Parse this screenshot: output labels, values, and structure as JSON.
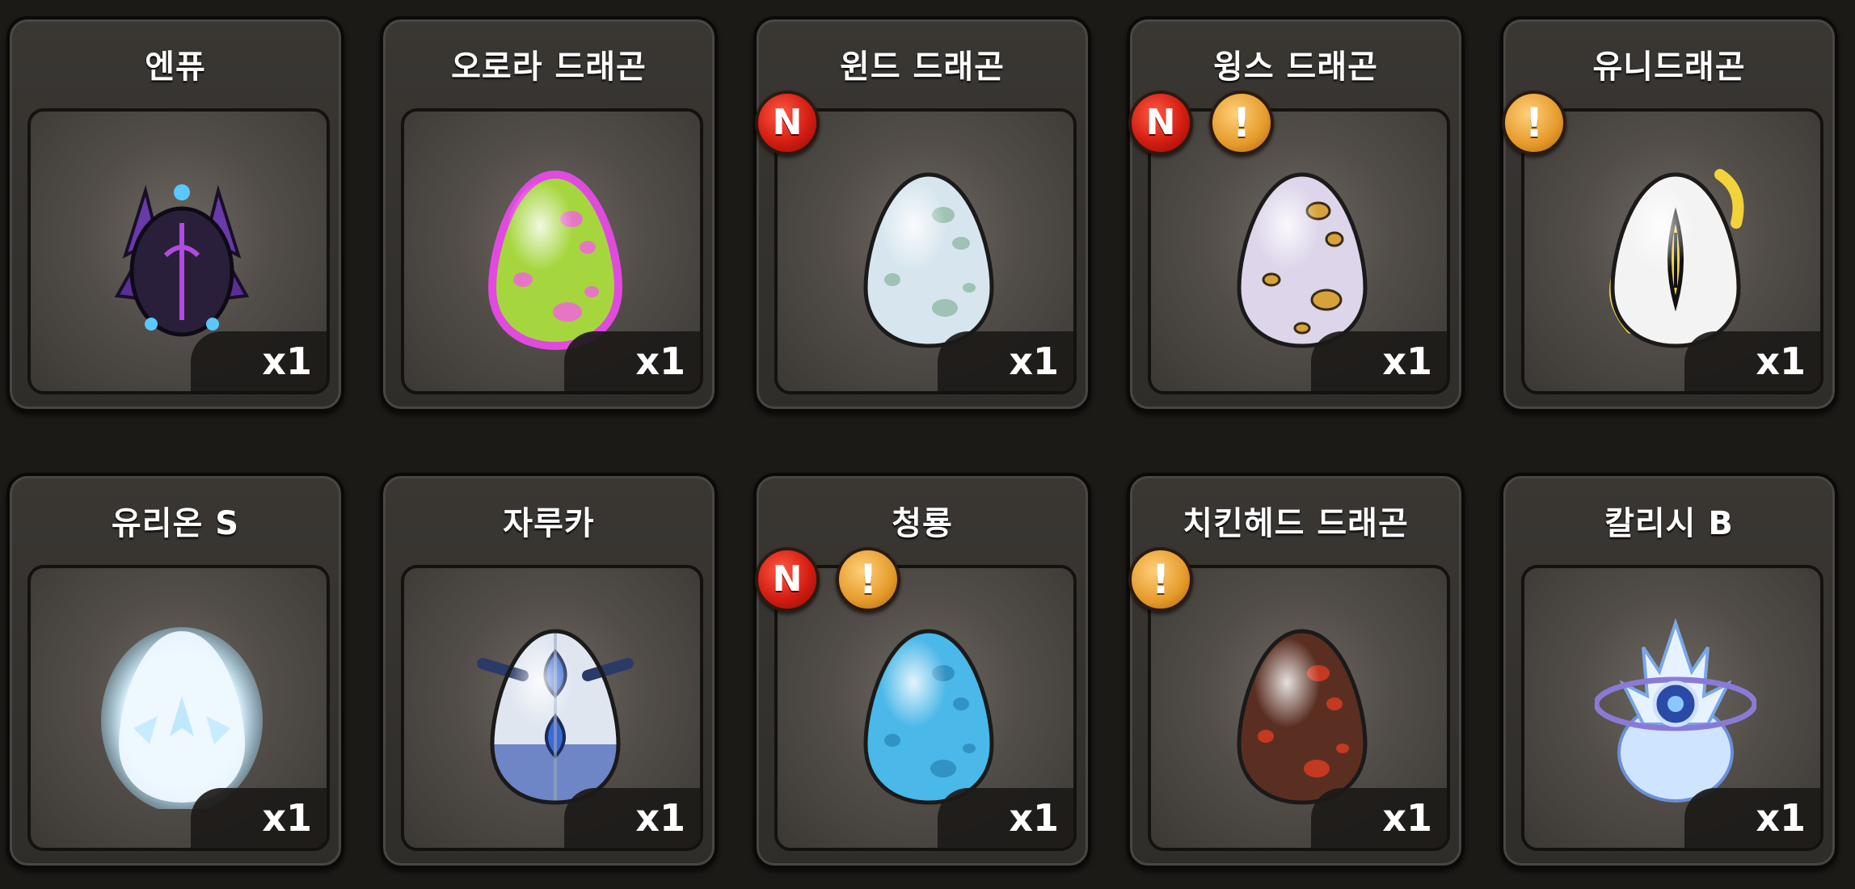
{
  "cards": [
    {
      "title": "엔퓨",
      "count": "x1",
      "icon": "dark-crest-egg-icon",
      "new_badge": false,
      "alert_badge": false
    },
    {
      "title": "오로라 드래곤",
      "count": "x1",
      "icon": "green-pink-egg-icon",
      "new_badge": false,
      "alert_badge": false
    },
    {
      "title": "윈드 드래곤",
      "count": "x1",
      "icon": "pale-blue-egg-icon",
      "new_badge": true,
      "alert_badge": false
    },
    {
      "title": "윙스 드래곤",
      "count": "x1",
      "icon": "lavender-egg-icon",
      "new_badge": true,
      "alert_badge": true
    },
    {
      "title": "유니드래곤",
      "count": "x1",
      "icon": "white-eye-egg-icon",
      "new_badge": false,
      "alert_badge": true
    },
    {
      "title": "유리온 S",
      "count": "x1",
      "icon": "glowing-white-egg-icon",
      "new_badge": false,
      "alert_badge": false
    },
    {
      "title": "자루카",
      "count": "x1",
      "icon": "armored-blue-egg-icon",
      "new_badge": false,
      "alert_badge": false
    },
    {
      "title": "청룡",
      "count": "x1",
      "icon": "sky-blue-egg-icon",
      "new_badge": true,
      "alert_badge": true
    },
    {
      "title": "치킨헤드 드래곤",
      "count": "x1",
      "icon": "brown-red-egg-icon",
      "new_badge": false,
      "alert_badge": true
    },
    {
      "title": "칼리시 B",
      "count": "x1",
      "icon": "crystal-ring-egg-icon",
      "new_badge": false,
      "alert_badge": false
    }
  ],
  "badges": {
    "new_label": "N",
    "alert_label": "!"
  },
  "colors": {
    "badge_new": "#d41d12",
    "badge_alert": "#e59a2a",
    "background": "#1b1a17"
  }
}
